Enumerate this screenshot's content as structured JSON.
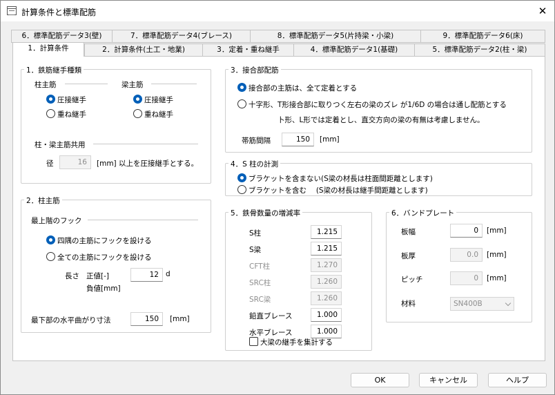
{
  "window": {
    "title": "計算条件と標準配筋",
    "close_glyph": "✕"
  },
  "tabs_back": [
    "6．標準配筋データ3(壁)",
    "7．標準配筋データ4(ブレース)",
    "8．標準配筋データ5(片持梁・小梁)",
    "9．標準配筋データ6(床)"
  ],
  "tabs_front": [
    "1．計算条件",
    "2．計算条件(土工・地業)",
    "3．定着・重ね継手",
    "4．標準配筋データ1(基礎)",
    "5．標準配筋データ2(柱・梁)"
  ],
  "g1": {
    "title": "1．鉄筋継手種類",
    "col_head": "柱主筋",
    "beam_head": "梁主筋",
    "opt_pressure": "圧接継手",
    "opt_lap": "重ね継手",
    "shared_title": "柱・梁主筋共用",
    "dia_label": "径",
    "dia_value": "16",
    "dia_unit": "[mm] 以上を圧接継手とする。"
  },
  "g2": {
    "title": "2．柱主筋",
    "hook_title": "最上階のフック",
    "opt_corner": "四隅の主筋にフックを設ける",
    "opt_all": "全ての主筋にフックを設ける",
    "len_label": "長さ",
    "pos_label": "正値[-]",
    "neg_label": "負値[mm]",
    "len_value": "12",
    "len_unit": "d",
    "bottom_label": "最下部の水平曲がり寸法",
    "bottom_value": "150",
    "bottom_unit": "[mm]"
  },
  "g3": {
    "title": "3．接合部配筋",
    "opt1": "接合部の主筋は、全て定着とする",
    "opt2": "十字形、T形接合部に取りつく左右の梁のズレ が1/6D の場合は通し配筋とする",
    "opt2_note": "卜形、L形では定着とし、直交方向の梁の有無は考慮しません。",
    "stirrup_label": "帯筋間隔",
    "stirrup_value": "150",
    "stirrup_unit": "[mm]"
  },
  "g4": {
    "title": "4．S 柱の計測",
    "opt1": "ブラケットを含まない(S梁の材長は柱面間距離とします)",
    "opt2": "ブラケットを含む　 (S梁の材長は継手間距離とします)"
  },
  "g5": {
    "title": "5．鉄骨数量の増減率",
    "rows": [
      {
        "label": "S柱",
        "value": "1.215",
        "enabled": true
      },
      {
        "label": "S梁",
        "value": "1.215",
        "enabled": true
      },
      {
        "label": "CFT柱",
        "value": "1.270",
        "enabled": false
      },
      {
        "label": "SRC柱",
        "value": "1.260",
        "enabled": false
      },
      {
        "label": "SRC梁",
        "value": "1.260",
        "enabled": false
      },
      {
        "label": "鉛直ブレース",
        "value": "1.000",
        "enabled": true
      },
      {
        "label": "水平ブレース",
        "value": "1.000",
        "enabled": true
      }
    ],
    "chk_label": "大梁の継手を集計する"
  },
  "g6": {
    "title": "6．バンドプレート",
    "width_label": "板幅",
    "width_value": "0",
    "width_unit": "[mm]",
    "thick_label": "板厚",
    "thick_value": "0.0",
    "thick_unit": "[mm]",
    "pitch_label": "ピッチ",
    "pitch_value": "0",
    "pitch_unit": "[mm]",
    "mat_label": "材料",
    "mat_value": "SN400B"
  },
  "buttons": {
    "ok": "OK",
    "cancel": "キャンセル",
    "help": "ヘルプ"
  }
}
